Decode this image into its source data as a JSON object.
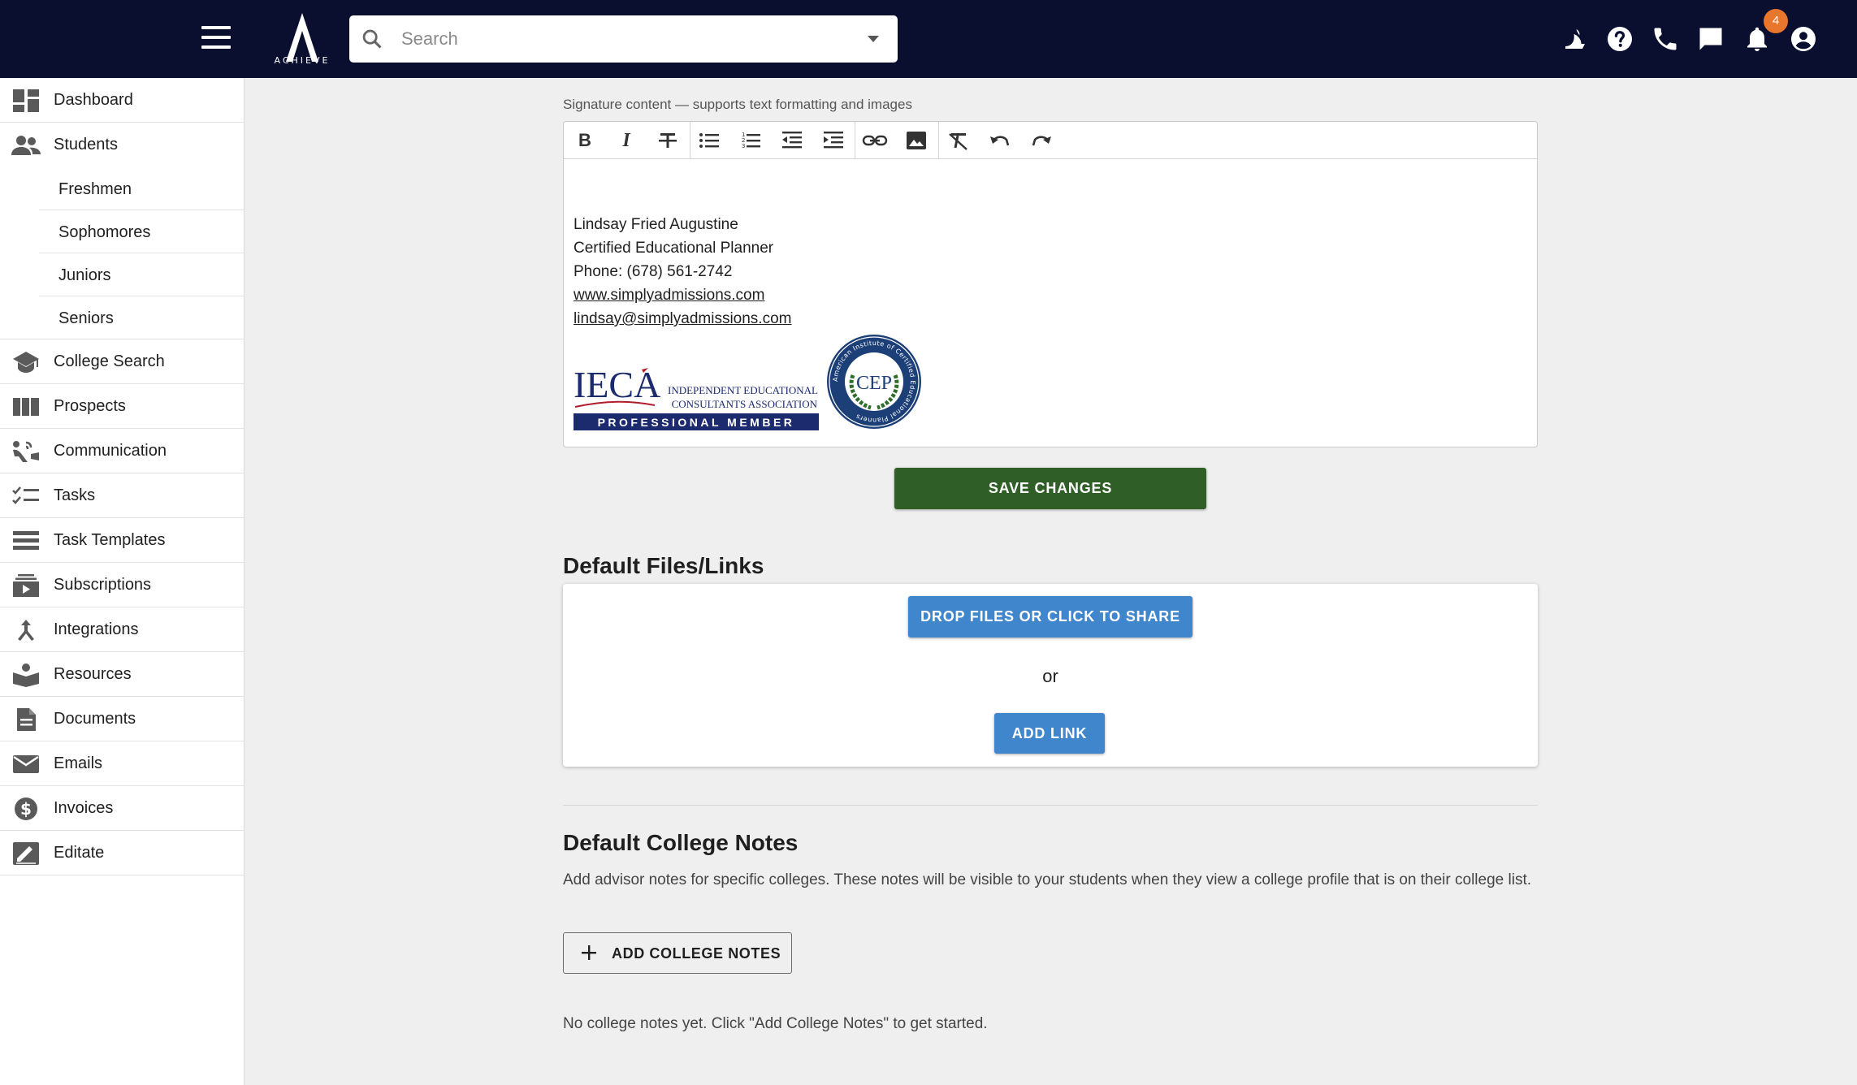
{
  "header": {
    "logo_text": "ACHIEVE",
    "search_placeholder": "Search",
    "notification_count": "4",
    "icons": [
      "menu-icon",
      "search-icon",
      "dropdown-arrow-icon",
      "dark-mode-icon",
      "help-icon",
      "phone-icon",
      "chat-icon",
      "notifications-icon",
      "account-icon"
    ]
  },
  "sidebar": {
    "items": [
      {
        "label": "Dashboard",
        "icon": "dashboard-icon"
      },
      {
        "label": "Students",
        "icon": "people-icon"
      },
      {
        "label": "College Search",
        "icon": "school-icon"
      },
      {
        "label": "Prospects",
        "icon": "columns-icon"
      },
      {
        "label": "Communication",
        "icon": "communication-icon"
      },
      {
        "label": "Tasks",
        "icon": "checklist-icon"
      },
      {
        "label": "Task Templates",
        "icon": "list-icon"
      },
      {
        "label": "Subscriptions",
        "icon": "subscriptions-icon"
      },
      {
        "label": "Integrations",
        "icon": "merge-icon"
      },
      {
        "label": "Resources",
        "icon": "book-icon"
      },
      {
        "label": "Documents",
        "icon": "document-icon"
      },
      {
        "label": "Emails",
        "icon": "email-icon"
      },
      {
        "label": "Invoices",
        "icon": "dollar-icon"
      },
      {
        "label": "Editate",
        "icon": "edit-note-icon"
      }
    ],
    "student_subitems": [
      "Freshmen",
      "Sophomores",
      "Juniors",
      "Seniors"
    ]
  },
  "signature": {
    "caption": "Signature content — supports text formatting and images",
    "toolbar": [
      "bold",
      "italic",
      "strikethrough",
      "bullet-list",
      "numbered-list",
      "outdent",
      "indent",
      "link",
      "image",
      "clear-format",
      "undo",
      "redo"
    ],
    "lines": {
      "name": "Lindsay Fried Augustine",
      "title": "Certified Educational Planner",
      "phone": "Phone: (678) 561-2742",
      "website": "www.simplyadmissions.com",
      "email": "lindsay@simplyadmissions.com"
    },
    "ieca_logo": {
      "brand": "IECA",
      "line1": "INDEPENDENT EDUCATIONAL",
      "line2": "CONSULTANTS ASSOCIATION",
      "band": "PROFESSIONAL MEMBER"
    },
    "cep_seal": {
      "center": "CEP",
      "ring_text": "American Institute of Certified Educational Planners"
    },
    "save_label": "SAVE CHANGES"
  },
  "files": {
    "heading": "Default Files/Links",
    "drop_label": "DROP FILES OR CLICK TO SHARE",
    "or_label": "or",
    "add_link_label": "ADD LINK"
  },
  "college_notes": {
    "heading": "Default College Notes",
    "description": "Add advisor notes for specific colleges. These notes will be visible to your students when they view a college profile that is on their college list.",
    "add_label": "ADD COLLEGE NOTES",
    "empty_message": "No college notes yet. Click \"Add College Notes\" to get started."
  },
  "colors": {
    "topbar": "#0a0f30",
    "save_button": "#2f5f26",
    "primary_button": "#3f86cc",
    "badge": "#e8762d"
  }
}
